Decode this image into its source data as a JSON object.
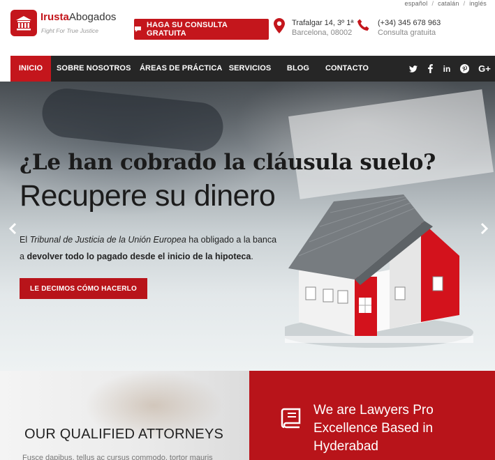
{
  "languages": [
    "español",
    "catalán",
    "inglés"
  ],
  "brand": {
    "name_red": "Irusta",
    "name_dark": "Abogados",
    "tagline": "Fight For True Justice",
    "accent": "#c4161c"
  },
  "header": {
    "cta_label": "HAGA SU CONSULTA GRATUITA",
    "address": {
      "line1": "Trafalgar 14, 3º 1ª",
      "line2": "Barcelona, 08002"
    },
    "phone": {
      "line1": "(+34) 345 678 963",
      "line2": "Consulta gratuita"
    }
  },
  "nav": {
    "items": [
      "INICIO",
      "SOBRE NOSOTROS",
      "ÁREAS DE PRÁCTICA",
      "SERVICIOS",
      "BLOG",
      "CONTACTO"
    ],
    "social": [
      "twitter-icon",
      "facebook-icon",
      "linkedin-icon",
      "pinterest-icon",
      "google-plus-icon"
    ]
  },
  "hero": {
    "title": "¿Le han cobrado la cláusula suelo?",
    "subtitle": "Recupere su dinero",
    "body": {
      "p1": "El ",
      "p1_italic": "Tribunal de Justicia de la Unión Europea",
      "p1_rest": " ha obligado a la banca",
      "p2": "a ",
      "p2_bold": "devolver todo lo pagado desde el inicio de la hipoteca",
      "p2_rest": "."
    },
    "button_label": "LE DECIMOS CÓMO HACERLO"
  },
  "attorneys": {
    "title": "OUR QUALIFIED ATTORNEYS",
    "text": "Fusce dapibus, tellus ac cursus commodo, tortor mauris"
  },
  "lawyers": {
    "lines": [
      "We are Lawyers Pro",
      "Excellence Based in",
      "Hyderabad"
    ]
  }
}
